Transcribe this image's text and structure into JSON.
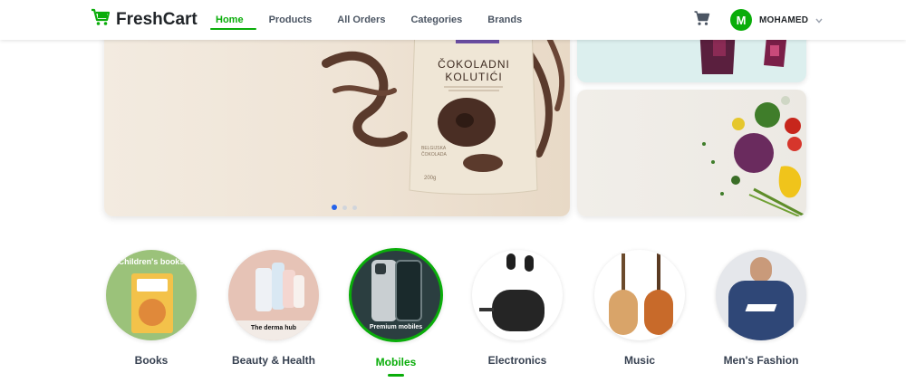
{
  "brand": {
    "name": "FreshCart",
    "icon": "cart-logo-icon",
    "color": "#0aad0a"
  },
  "nav": {
    "links": [
      {
        "label": "Home",
        "active": true
      },
      {
        "label": "Products",
        "active": false
      },
      {
        "label": "All Orders",
        "active": false
      },
      {
        "label": "Categories",
        "active": false
      },
      {
        "label": "Brands",
        "active": false
      }
    ]
  },
  "header": {
    "cart_icon": "cart-icon",
    "user": {
      "initial": "M",
      "name": "MOHAMED",
      "dropdown_icon": "chevron-down-icon"
    }
  },
  "slider": {
    "main_slide": {
      "product_title": "ČOKOLADNI",
      "product_subtitle": "KOLUTIĆI",
      "weight": "200g"
    },
    "dots": [
      {
        "active": true
      },
      {
        "active": false
      },
      {
        "active": false
      }
    ]
  },
  "categories": {
    "items": [
      {
        "label": "Books",
        "caption_top": "Children's books",
        "caption_bottom": "",
        "active": false
      },
      {
        "label": "Beauty & Health",
        "caption_top": "",
        "caption_bottom": "The derma hub",
        "active": false
      },
      {
        "label": "Mobiles",
        "caption_top": "",
        "caption_bottom": "Premium mobiles",
        "active": true
      },
      {
        "label": "Electronics",
        "caption_top": "",
        "caption_bottom": "",
        "active": false
      },
      {
        "label": "Music",
        "caption_top": "",
        "caption_bottom": "",
        "active": false
      },
      {
        "label": "Men's Fashion",
        "caption_top": "",
        "caption_bottom": "",
        "active": false
      }
    ]
  },
  "colors": {
    "accent": "#0aad0a",
    "text": "#212529",
    "muted": "#4b5563",
    "slider_dot_active": "#2563eb"
  }
}
